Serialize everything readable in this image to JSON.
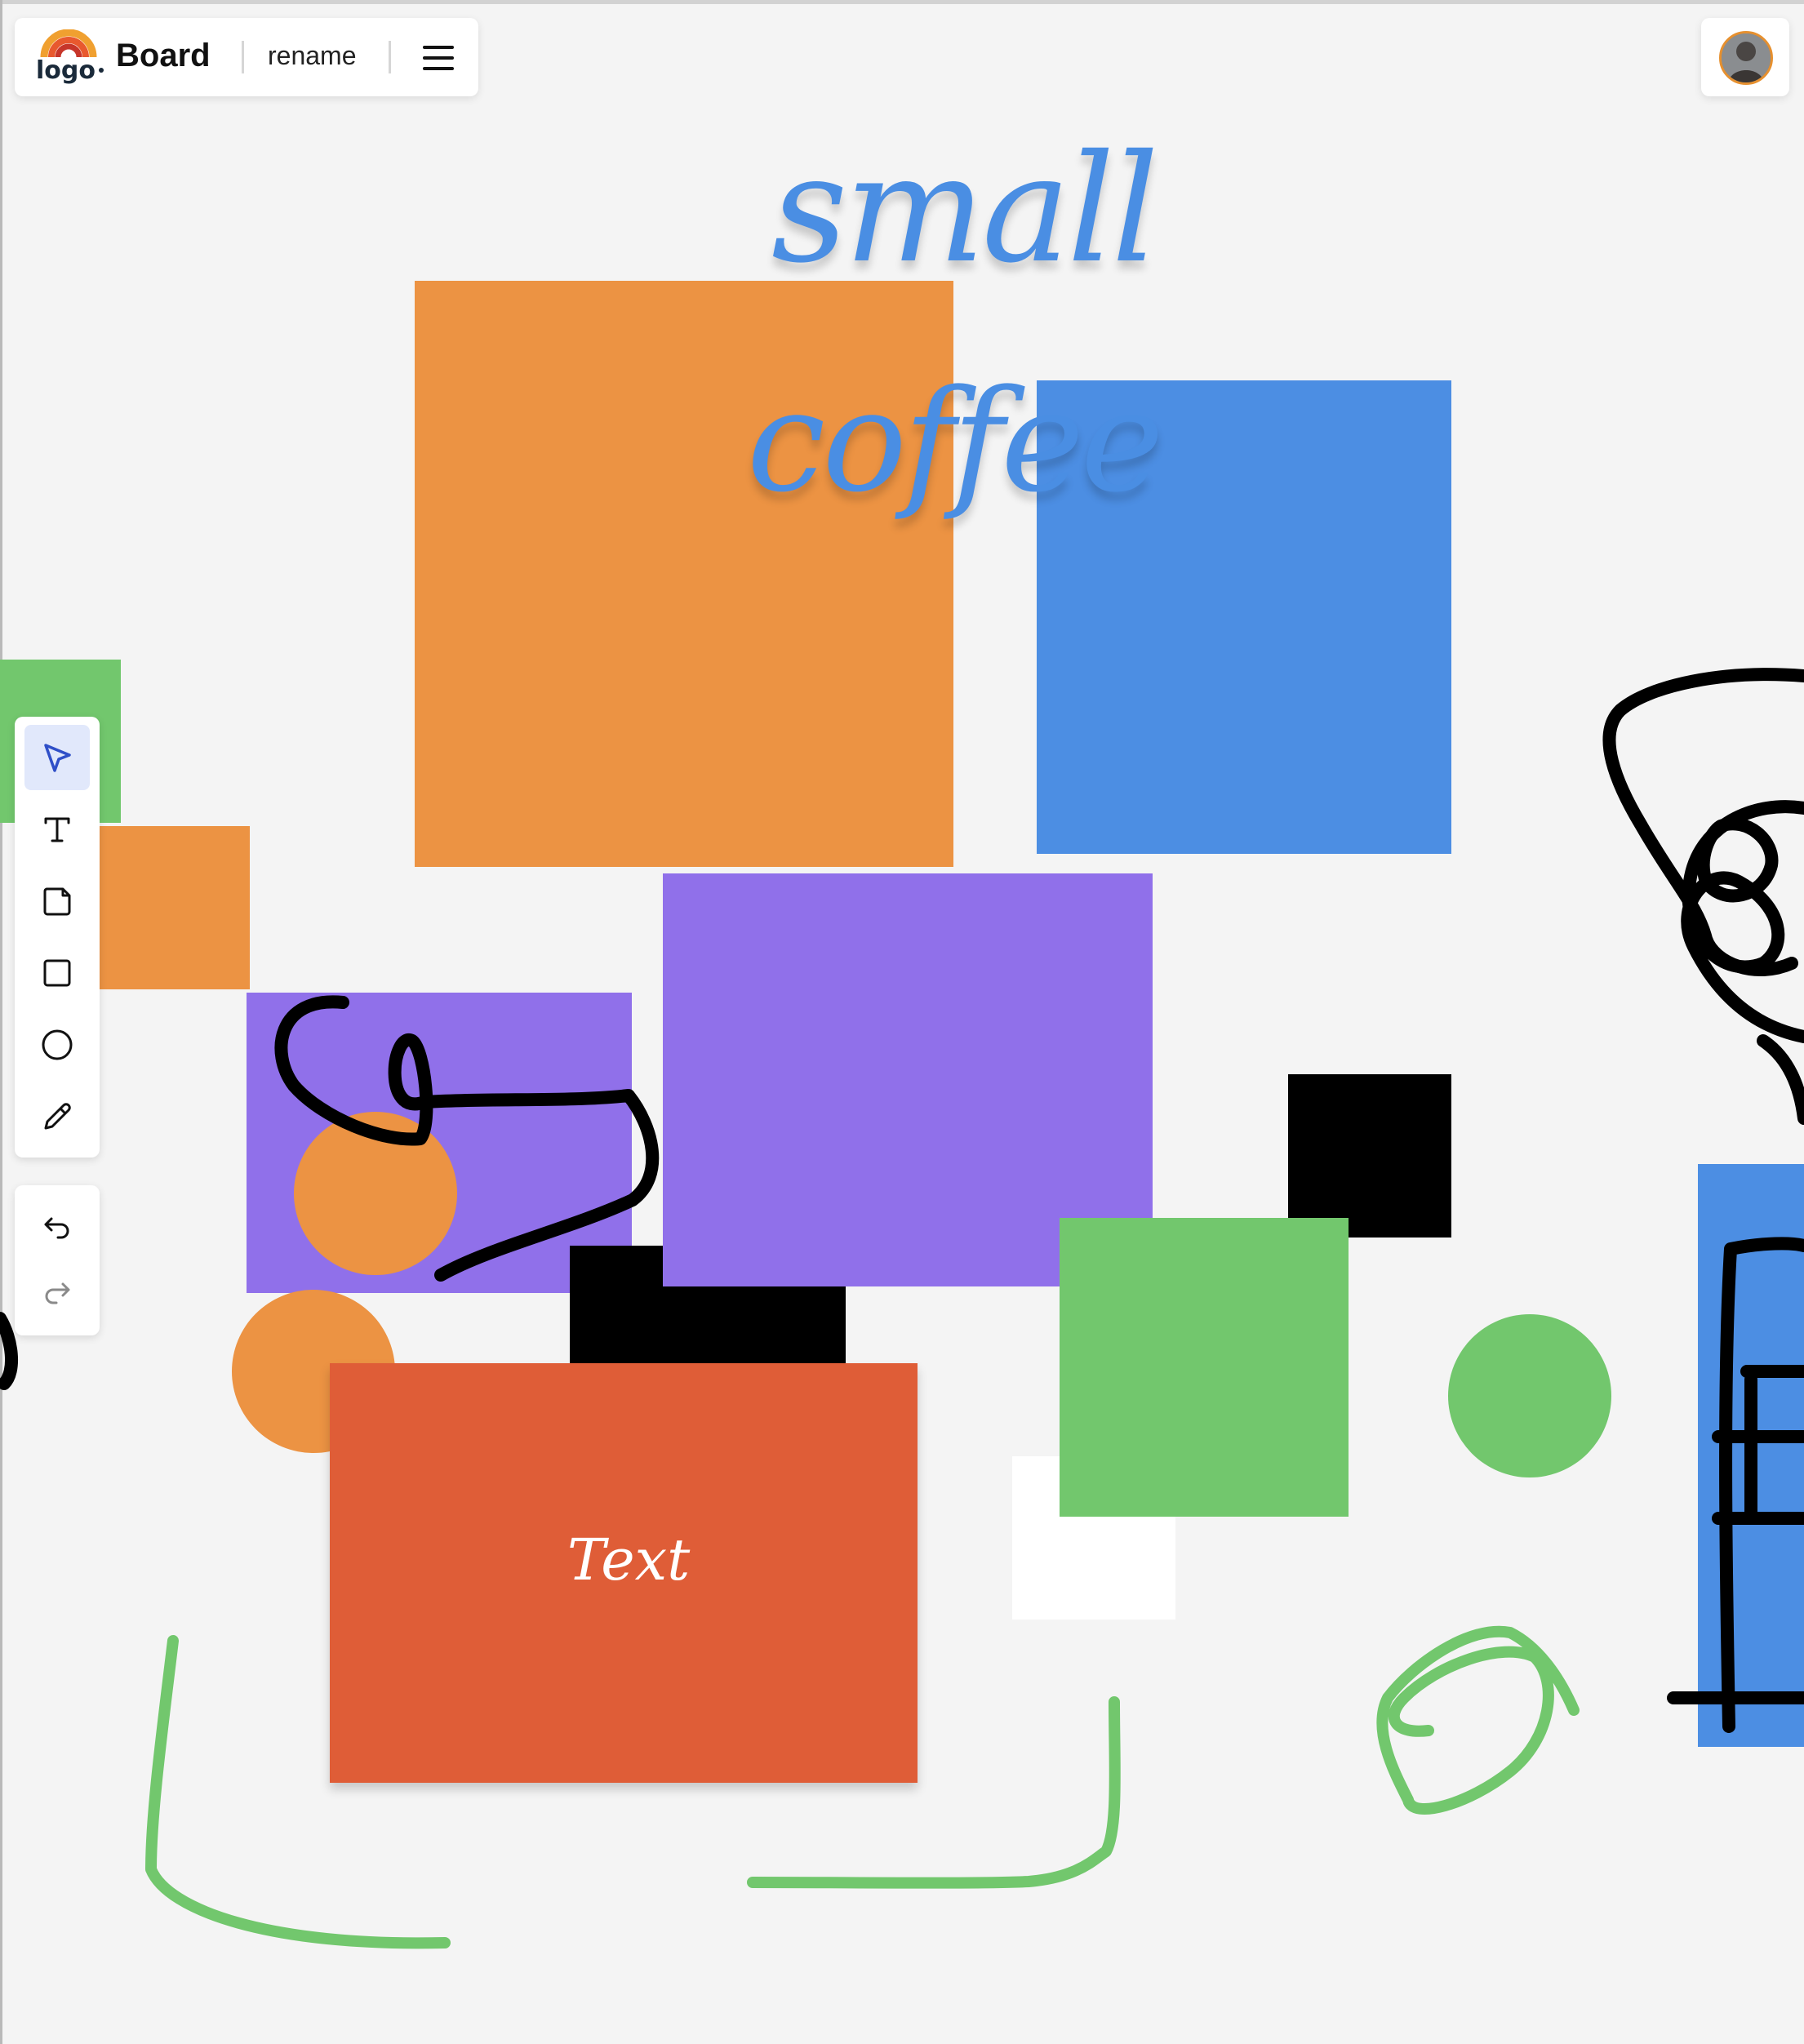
{
  "app": {
    "board_title": "Board",
    "rename_label": "rename",
    "logo_alt": "logo ipsum"
  },
  "icons": {
    "menu": "hamburger-menu-icon",
    "avatar": "user-avatar",
    "tools": [
      "select-cursor-icon",
      "text-icon",
      "sticky-note-icon",
      "rectangle-icon",
      "circle-icon",
      "pencil-icon"
    ],
    "history": [
      "undo-icon",
      "redo-icon"
    ]
  },
  "toolbar": {
    "active_tool": "select"
  },
  "canvas": {
    "words": {
      "small": "small",
      "coffee": "coffee",
      "text_note": "Text"
    },
    "colors": {
      "background": "#f4f4f4",
      "orange": "#ec9343",
      "blue": "#4c8ee3",
      "purple": "#9070ea",
      "green": "#72c76d",
      "black": "#000000",
      "red_orange": "#df5d37",
      "white": "#ffffff",
      "ink_black": "#000000",
      "ink_green": "#72c76d"
    }
  }
}
